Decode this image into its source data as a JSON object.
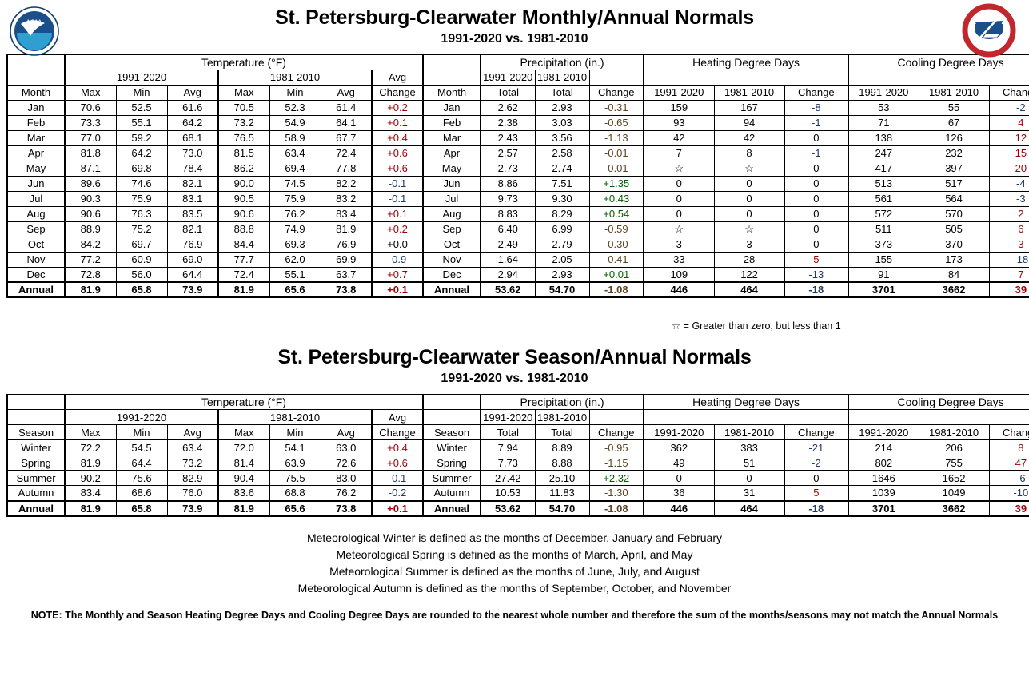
{
  "header": {
    "title": "St. Petersburg-Clearwater Monthly/Annual Normals",
    "subtitle": "1991-2020 vs. 1981-2010",
    "noaa_logo_alt": "NOAA",
    "nws_logo_alt": "National Weather Service"
  },
  "header2": {
    "title": "St. Petersburg-Clearwater Season/Annual Normals",
    "subtitle": "1991-2020 vs. 1981-2010"
  },
  "groups": {
    "temperature": "Temperature (°F)",
    "precipitation": "Precipitation (in.)",
    "heating": "Heating Degree Days",
    "cooling": "Cooling Degree Days"
  },
  "periods": {
    "new": "1991-2020",
    "old": "1981-2010"
  },
  "columns": {
    "month": "Month",
    "season": "Season",
    "max": "Max",
    "min": "Min",
    "avg": "Avg",
    "avg_change_1": "Avg",
    "avg_change_2": "Change",
    "total": "Total",
    "change": "Change"
  },
  "footnotes": {
    "star": "☆ = Greater than zero, but less than 1",
    "winter": "Meteorological Winter is defined as the months of December, January and February",
    "spring": "Meteorological Spring is defined as the months of March, April, and May",
    "summer": "Meteorological Summer is defined as the months of June, July, and August",
    "autumn": "Meteorological Autumn is defined as the months of September, October, and November",
    "note": "NOTE:  The Monthly and Season Heating Degree Days and Cooling Degree Days are rounded to the nearest whole number and therefore the sum of the months/seasons may not match the Annual Normals"
  },
  "colors": {
    "positive_temp_bg": "#f8cbcd",
    "positive_temp_fg": "#9c0006",
    "negative_temp_bg": "#bdd7ee",
    "negative_temp_fg": "#1f3864",
    "positive_precip_bg": "#c6efce",
    "positive_precip_fg": "#006100",
    "negative_precip_bg": "#ddcbb0",
    "negative_precip_fg": "#5b4420"
  },
  "chart_data": {
    "type": "table",
    "title": "St. Petersburg-Clearwater Monthly/Annual Normals 1991-2020 vs. 1981-2010",
    "monthly": {
      "labels": [
        "Jan",
        "Feb",
        "Mar",
        "Apr",
        "May",
        "Jun",
        "Jul",
        "Aug",
        "Sep",
        "Oct",
        "Nov",
        "Dec",
        "Annual"
      ],
      "temp_new_max": [
        "70.6",
        "73.3",
        "77.0",
        "81.8",
        "87.1",
        "89.6",
        "90.3",
        "90.6",
        "88.9",
        "84.2",
        "77.2",
        "72.8",
        "81.9"
      ],
      "temp_new_min": [
        "52.5",
        "55.1",
        "59.2",
        "64.2",
        "69.8",
        "74.6",
        "75.9",
        "76.3",
        "75.2",
        "69.7",
        "60.9",
        "56.0",
        "65.8"
      ],
      "temp_new_avg": [
        "61.6",
        "64.2",
        "68.1",
        "73.0",
        "78.4",
        "82.1",
        "83.1",
        "83.5",
        "82.1",
        "76.9",
        "69.0",
        "64.4",
        "73.9"
      ],
      "temp_old_max": [
        "70.5",
        "73.2",
        "76.5",
        "81.5",
        "86.2",
        "90.0",
        "90.5",
        "90.6",
        "88.8",
        "84.4",
        "77.7",
        "72.4",
        "81.9"
      ],
      "temp_old_min": [
        "52.3",
        "54.9",
        "58.9",
        "63.4",
        "69.4",
        "74.5",
        "75.9",
        "76.2",
        "74.9",
        "69.3",
        "62.0",
        "55.1",
        "65.6"
      ],
      "temp_old_avg": [
        "61.4",
        "64.1",
        "67.7",
        "72.4",
        "77.8",
        "82.2",
        "83.2",
        "83.4",
        "81.9",
        "76.9",
        "69.9",
        "63.7",
        "73.8"
      ],
      "temp_change": [
        "+0.2",
        "+0.1",
        "+0.4",
        "+0.6",
        "+0.6",
        "-0.1",
        "-0.1",
        "+0.1",
        "+0.2",
        "+0.0",
        "-0.9",
        "+0.7",
        "+0.1"
      ],
      "precip_new": [
        "2.62",
        "2.38",
        "2.43",
        "2.57",
        "2.73",
        "8.86",
        "9.73",
        "8.83",
        "6.40",
        "2.49",
        "1.64",
        "2.94",
        "53.62"
      ],
      "precip_old": [
        "2.93",
        "3.03",
        "3.56",
        "2.58",
        "2.74",
        "7.51",
        "9.30",
        "8.29",
        "6.99",
        "2.79",
        "2.05",
        "2.93",
        "54.70"
      ],
      "precip_change": [
        "-0.31",
        "-0.65",
        "-1.13",
        "-0.01",
        "-0.01",
        "+1.35",
        "+0.43",
        "+0.54",
        "-0.59",
        "-0.30",
        "-0.41",
        "+0.01",
        "-1.08"
      ],
      "hdd_new": [
        "159",
        "93",
        "42",
        "7",
        "☆",
        "0",
        "0",
        "0",
        "☆",
        "3",
        "33",
        "109",
        "446"
      ],
      "hdd_old": [
        "167",
        "94",
        "42",
        "8",
        "☆",
        "0",
        "0",
        "0",
        "☆",
        "3",
        "28",
        "122",
        "464"
      ],
      "hdd_change": [
        "-8",
        "-1",
        "0",
        "-1",
        "0",
        "0",
        "0",
        "0",
        "0",
        "0",
        "5",
        "-13",
        "-18"
      ],
      "cdd_new": [
        "53",
        "71",
        "138",
        "247",
        "417",
        "513",
        "561",
        "572",
        "511",
        "373",
        "155",
        "91",
        "3701"
      ],
      "cdd_old": [
        "55",
        "67",
        "126",
        "232",
        "397",
        "517",
        "564",
        "570",
        "505",
        "370",
        "173",
        "84",
        "3662"
      ],
      "cdd_change": [
        "-2",
        "4",
        "12",
        "15",
        "20",
        "-4",
        "-3",
        "2",
        "6",
        "3",
        "-18",
        "7",
        "39"
      ]
    },
    "seasonal": {
      "labels": [
        "Winter",
        "Spring",
        "Summer",
        "Autumn",
        "Annual"
      ],
      "temp_new_max": [
        "72.2",
        "81.9",
        "90.2",
        "83.4",
        "81.9"
      ],
      "temp_new_min": [
        "54.5",
        "64.4",
        "75.6",
        "68.6",
        "65.8"
      ],
      "temp_new_avg": [
        "63.4",
        "73.2",
        "82.9",
        "76.0",
        "73.9"
      ],
      "temp_old_max": [
        "72.0",
        "81.4",
        "90.4",
        "83.6",
        "81.9"
      ],
      "temp_old_min": [
        "54.1",
        "63.9",
        "75.5",
        "68.8",
        "65.6"
      ],
      "temp_old_avg": [
        "63.0",
        "72.6",
        "83.0",
        "76.2",
        "73.8"
      ],
      "temp_change": [
        "+0.4",
        "+0.6",
        "-0.1",
        "-0.2",
        "+0.1"
      ],
      "precip_new": [
        "7.94",
        "7.73",
        "27.42",
        "10.53",
        "53.62"
      ],
      "precip_old": [
        "8.89",
        "8.88",
        "25.10",
        "11.83",
        "54.70"
      ],
      "precip_change": [
        "-0.95",
        "-1.15",
        "+2.32",
        "-1.30",
        "-1.08"
      ],
      "hdd_new": [
        "362",
        "49",
        "0",
        "36",
        "446"
      ],
      "hdd_old": [
        "383",
        "51",
        "0",
        "31",
        "464"
      ],
      "hdd_change": [
        "-21",
        "-2",
        "0",
        "5",
        "-18"
      ],
      "cdd_new": [
        "214",
        "802",
        "1646",
        "1039",
        "3701"
      ],
      "cdd_old": [
        "206",
        "755",
        "1652",
        "1049",
        "3662"
      ],
      "cdd_change": [
        "8",
        "47",
        "-6",
        "-10",
        "39"
      ]
    }
  }
}
